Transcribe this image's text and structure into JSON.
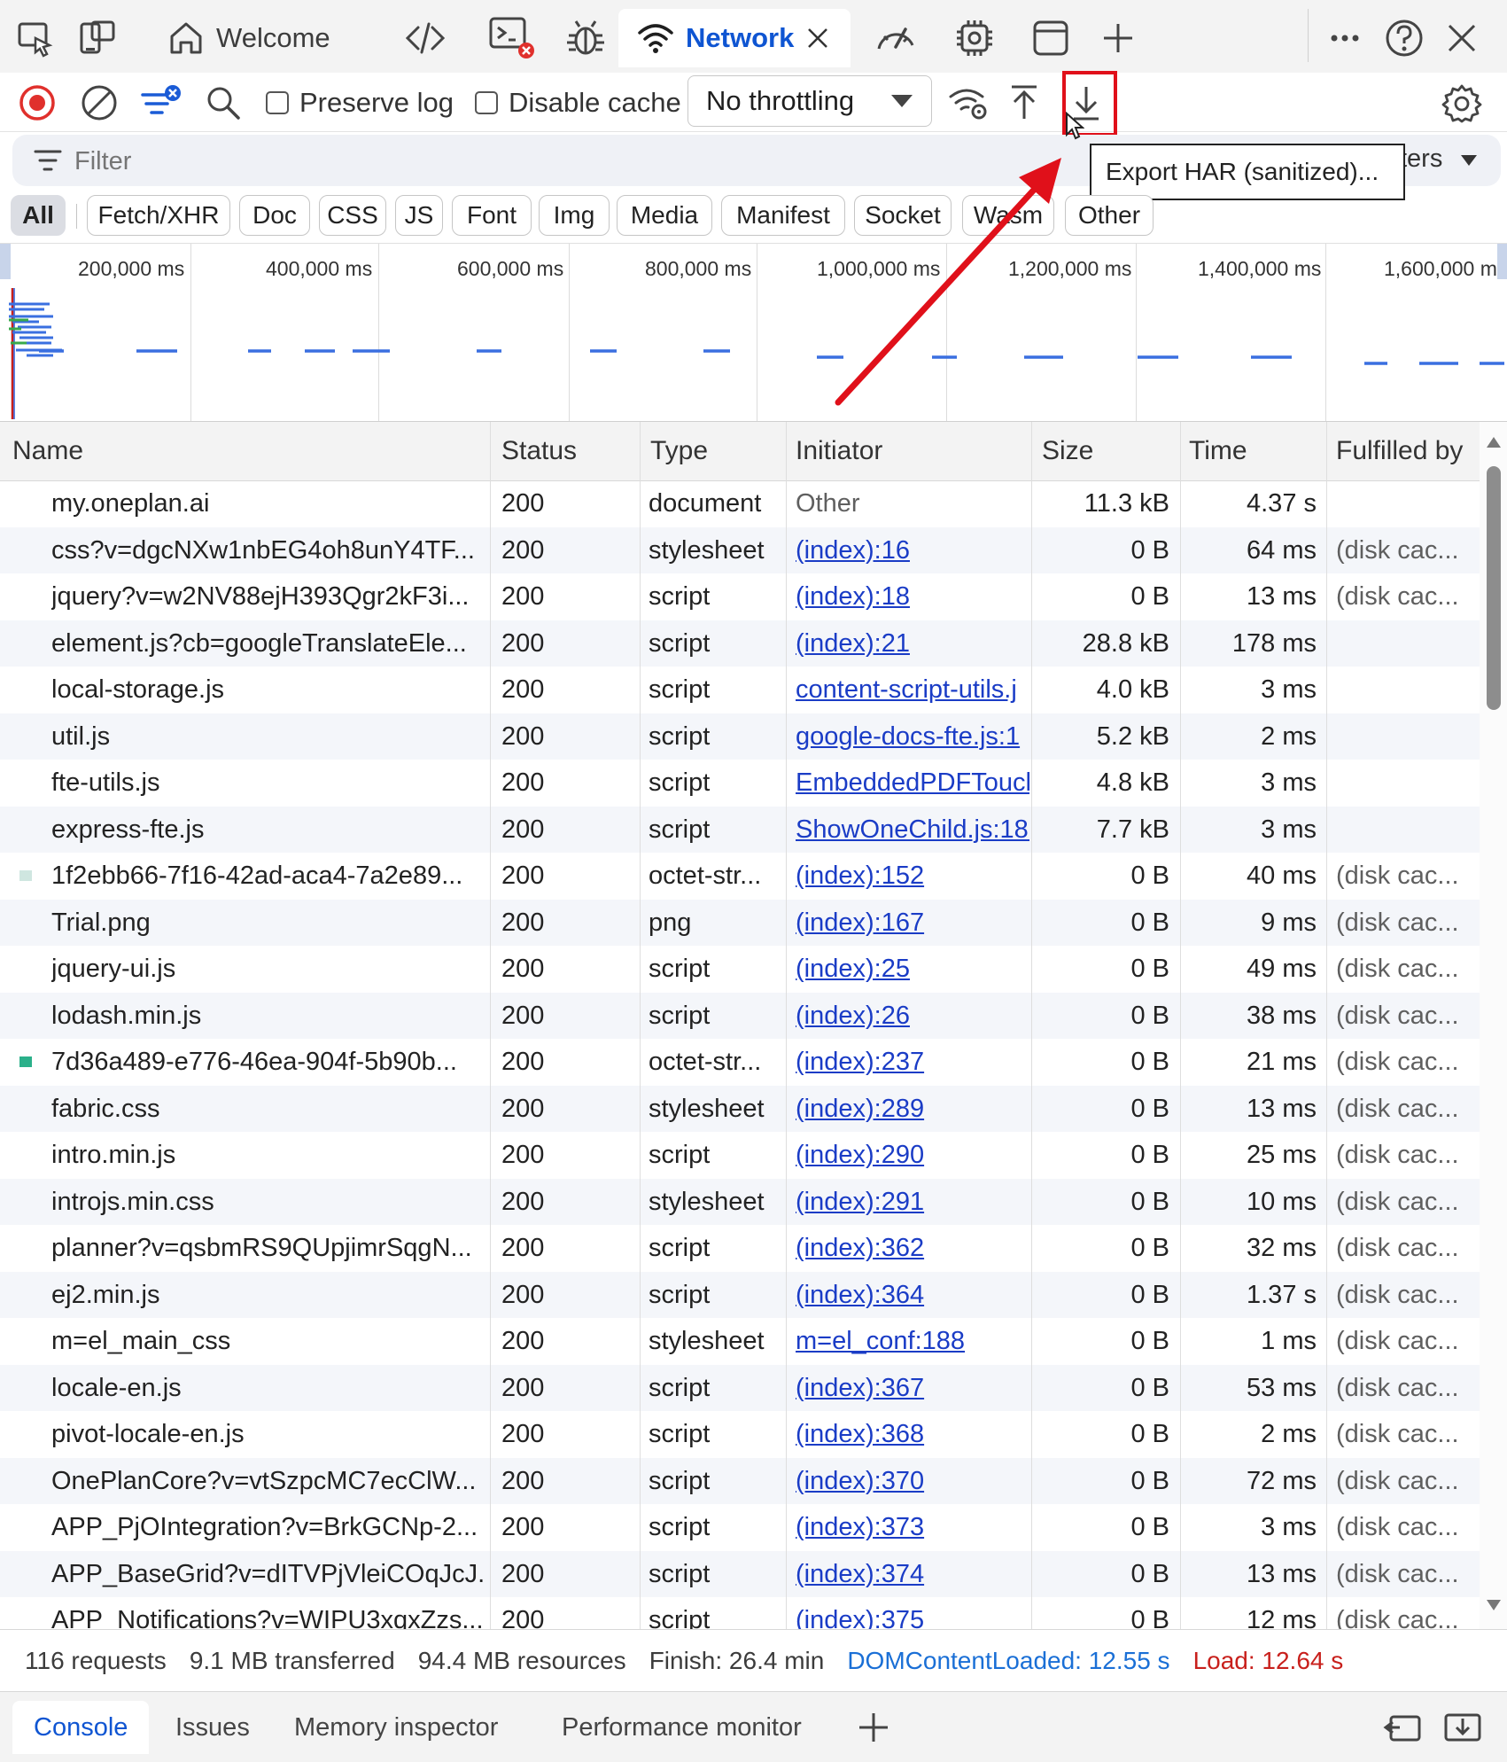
{
  "tabs": {
    "welcome": "Welcome",
    "network": "Network"
  },
  "toolbar": {
    "preserve_log": "Preserve log",
    "disable_cache": "Disable cache",
    "throttling": "No throttling",
    "tooltip": "Export HAR (sanitized)..."
  },
  "filter": {
    "placeholder": "Filter",
    "more_filters_partial": "ters"
  },
  "type_filters": [
    "All",
    "Fetch/XHR",
    "Doc",
    "CSS",
    "JS",
    "Font",
    "Img",
    "Media",
    "Manifest",
    "Socket",
    "Wasm",
    "Other"
  ],
  "overview": {
    "ticks": [
      "200,000 ms",
      "400,000 ms",
      "600,000 ms",
      "800,000 ms",
      "1,000,000 ms",
      "1,200,000 ms",
      "1,400,000 ms",
      "1,600,000 m"
    ]
  },
  "table": {
    "headers": {
      "name": "Name",
      "status": "Status",
      "type": "Type",
      "initiator": "Initiator",
      "size": "Size",
      "time": "Time",
      "fulfilled": "Fulfilled by"
    },
    "rows": [
      {
        "name": "my.oneplan.ai",
        "status": "200",
        "type": "document",
        "initiator": "Other",
        "size": "11.3 kB",
        "time": "4.37 s",
        "fulfilled": ""
      },
      {
        "name": "css?v=dgcNXw1nbEG4oh8unY4TF...",
        "status": "200",
        "type": "stylesheet",
        "initiator": "(index):16",
        "size": "0 B",
        "time": "64 ms",
        "fulfilled": "(disk cac..."
      },
      {
        "name": "jquery?v=w2NV88ejH393Qgr2kF3i...",
        "status": "200",
        "type": "script",
        "initiator": "(index):18",
        "size": "0 B",
        "time": "13 ms",
        "fulfilled": "(disk cac..."
      },
      {
        "name": "element.js?cb=googleTranslateEle...",
        "status": "200",
        "type": "script",
        "initiator": "(index):21",
        "size": "28.8 kB",
        "time": "178 ms",
        "fulfilled": ""
      },
      {
        "name": "local-storage.js",
        "status": "200",
        "type": "script",
        "initiator": "content-script-utils.j",
        "size": "4.0 kB",
        "time": "3 ms",
        "fulfilled": ""
      },
      {
        "name": "util.js",
        "status": "200",
        "type": "script",
        "initiator": "google-docs-fte.js:1",
        "size": "5.2 kB",
        "time": "2 ms",
        "fulfilled": ""
      },
      {
        "name": "fte-utils.js",
        "status": "200",
        "type": "script",
        "initiator": "EmbeddedPDFTouch",
        "size": "4.8 kB",
        "time": "3 ms",
        "fulfilled": ""
      },
      {
        "name": "express-fte.js",
        "status": "200",
        "type": "script",
        "initiator": "ShowOneChild.js:18.",
        "size": "7.7 kB",
        "time": "3 ms",
        "fulfilled": ""
      },
      {
        "name": "1f2ebb66-7f16-42ad-aca4-7a2e89...",
        "status": "200",
        "type": "octet-str...",
        "initiator": "(index):152",
        "size": "0 B",
        "time": "40 ms",
        "fulfilled": "(disk cac..."
      },
      {
        "name": "Trial.png",
        "status": "200",
        "type": "png",
        "initiator": "(index):167",
        "size": "0 B",
        "time": "9 ms",
        "fulfilled": "(disk cac..."
      },
      {
        "name": "jquery-ui.js",
        "status": "200",
        "type": "script",
        "initiator": "(index):25",
        "size": "0 B",
        "time": "49 ms",
        "fulfilled": "(disk cac..."
      },
      {
        "name": "lodash.min.js",
        "status": "200",
        "type": "script",
        "initiator": "(index):26",
        "size": "0 B",
        "time": "38 ms",
        "fulfilled": "(disk cac..."
      },
      {
        "name": "7d36a489-e776-46ea-904f-5b90b...",
        "status": "200",
        "type": "octet-str...",
        "initiator": "(index):237",
        "size": "0 B",
        "time": "21 ms",
        "fulfilled": "(disk cac..."
      },
      {
        "name": "fabric.css",
        "status": "200",
        "type": "stylesheet",
        "initiator": "(index):289",
        "size": "0 B",
        "time": "13 ms",
        "fulfilled": "(disk cac..."
      },
      {
        "name": "intro.min.js",
        "status": "200",
        "type": "script",
        "initiator": "(index):290",
        "size": "0 B",
        "time": "25 ms",
        "fulfilled": "(disk cac..."
      },
      {
        "name": "introjs.min.css",
        "status": "200",
        "type": "stylesheet",
        "initiator": "(index):291",
        "size": "0 B",
        "time": "10 ms",
        "fulfilled": "(disk cac..."
      },
      {
        "name": "planner?v=qsbmRS9QUpjimrSqgN...",
        "status": "200",
        "type": "script",
        "initiator": "(index):362",
        "size": "0 B",
        "time": "32 ms",
        "fulfilled": "(disk cac..."
      },
      {
        "name": "ej2.min.js",
        "status": "200",
        "type": "script",
        "initiator": "(index):364",
        "size": "0 B",
        "time": "1.37 s",
        "fulfilled": "(disk cac..."
      },
      {
        "name": "m=el_main_css",
        "status": "200",
        "type": "stylesheet",
        "initiator": "m=el_conf:188",
        "size": "0 B",
        "time": "1 ms",
        "fulfilled": "(disk cac..."
      },
      {
        "name": "locale-en.js",
        "status": "200",
        "type": "script",
        "initiator": "(index):367",
        "size": "0 B",
        "time": "53 ms",
        "fulfilled": "(disk cac..."
      },
      {
        "name": "pivot-locale-en.js",
        "status": "200",
        "type": "script",
        "initiator": "(index):368",
        "size": "0 B",
        "time": "2 ms",
        "fulfilled": "(disk cac..."
      },
      {
        "name": "OnePlanCore?v=vtSzpcMC7ecClW...",
        "status": "200",
        "type": "script",
        "initiator": "(index):370",
        "size": "0 B",
        "time": "72 ms",
        "fulfilled": "(disk cac..."
      },
      {
        "name": "APP_PjOIntegration?v=BrkGCNp-2...",
        "status": "200",
        "type": "script",
        "initiator": "(index):373",
        "size": "0 B",
        "time": "3 ms",
        "fulfilled": "(disk cac..."
      },
      {
        "name": "APP_BaseGrid?v=dITVPjVleiCOqJcJ...",
        "status": "200",
        "type": "script",
        "initiator": "(index):374",
        "size": "0 B",
        "time": "13 ms",
        "fulfilled": "(disk cac..."
      },
      {
        "name": "APP_Notifications?v=WIPU3xqxZzs...",
        "status": "200",
        "type": "script",
        "initiator": "(index):375",
        "size": "0 B",
        "time": "12 ms",
        "fulfilled": "(disk cac..."
      }
    ]
  },
  "status_bar": {
    "requests": "116 requests",
    "transferred": "9.1 MB transferred",
    "resources": "94.4 MB resources",
    "finish": "Finish: 26.4 min",
    "dcl": "DOMContentLoaded: 12.55 s",
    "load": "Load: 12.64 s"
  },
  "drawer": {
    "tabs": [
      "Console",
      "Issues",
      "Memory inspector",
      "Performance monitor"
    ]
  },
  "colors": {
    "accent": "#0f55d2",
    "record_red": "#e0302c",
    "highlight_red": "#e0101a",
    "link": "#1a3cc6",
    "dcl_blue": "#1a6fd6",
    "load_red": "#c8201c"
  }
}
